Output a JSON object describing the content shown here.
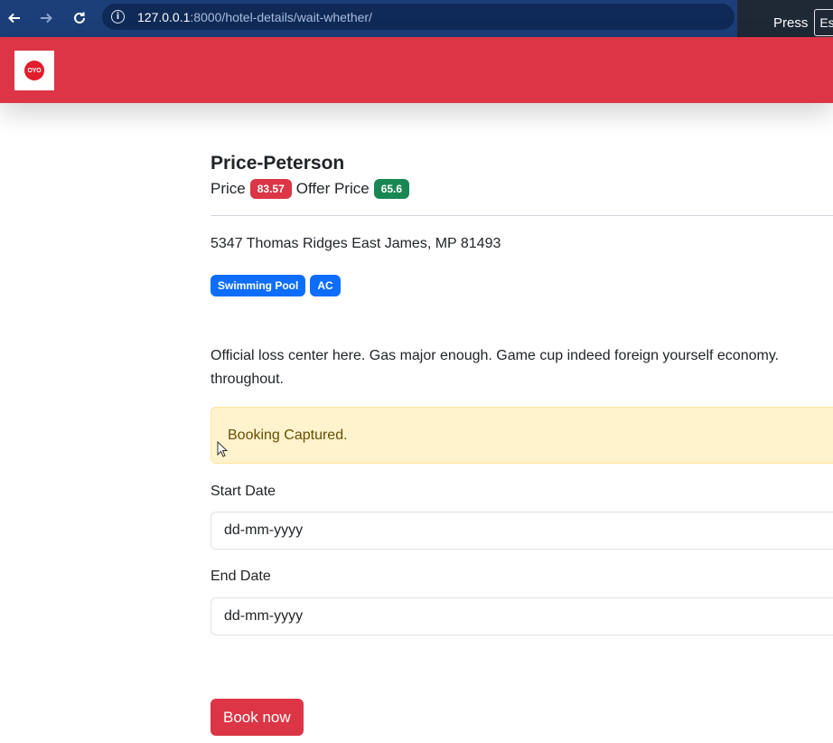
{
  "browser": {
    "url_host": "127.0.0.1",
    "url_path": ":8000/hotel-details/wait-whether/",
    "overlay_text": "Press",
    "overlay_key": "Esc"
  },
  "navbar": {
    "logo_text": "OYO",
    "brand_color": "#dc3545"
  },
  "hotel": {
    "name": "Price-Peterson",
    "price_label": "Price",
    "price": "83.57",
    "offer_label": "Offer Price",
    "offer_price": "65.6",
    "address": "5347 Thomas Ridges East James, MP 81493",
    "amenities": [
      "Swimming Pool",
      "AC"
    ],
    "description": "Official loss center here. Gas major enough. Game cup indeed foreign yourself economy. throughout."
  },
  "alert": {
    "message": "Booking Captured."
  },
  "form": {
    "start_label": "Start Date",
    "start_placeholder": "dd-mm-yyyy",
    "end_label": "End Date",
    "end_placeholder": "dd-mm-yyyy",
    "submit_label": "Book now"
  }
}
